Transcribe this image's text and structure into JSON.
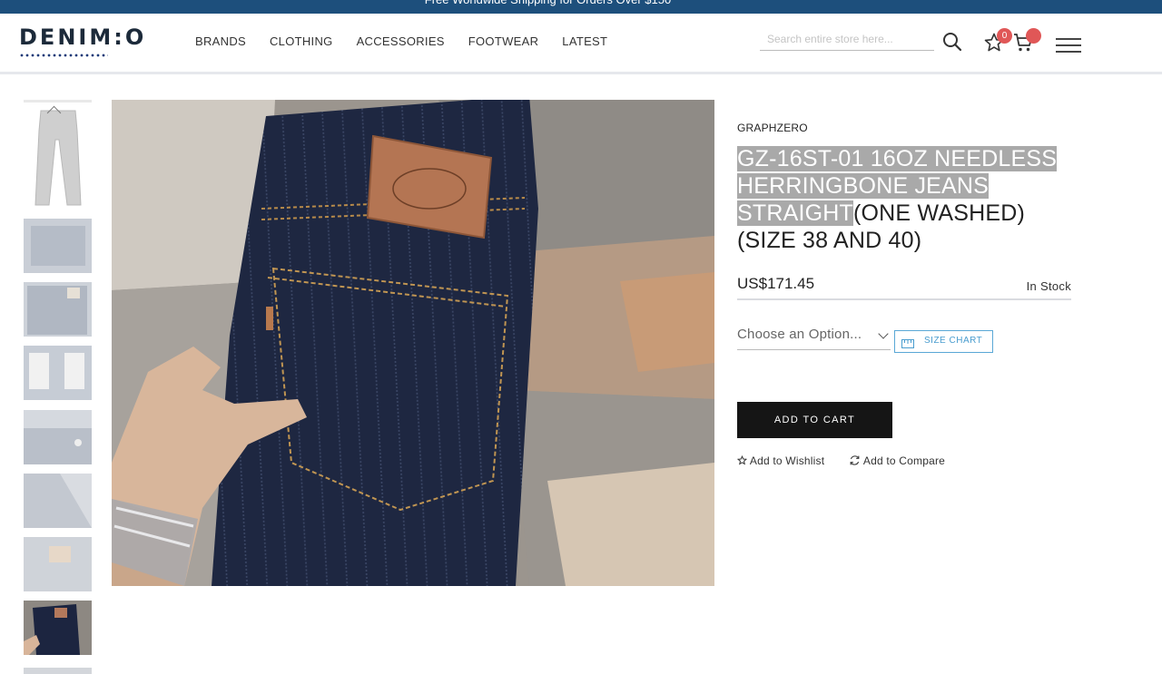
{
  "topbar": {
    "text": "Free Worldwide Shipping for Orders Over $150"
  },
  "header": {
    "logo": "DENIM:O",
    "nav": [
      "BRANDS",
      "CLOTHING",
      "ACCESSORIES",
      "FOOTWEAR",
      "LATEST"
    ],
    "search": {
      "placeholder": "Search entire store here...",
      "value": ""
    },
    "wishlist_count": "0",
    "cart_count": ""
  },
  "product": {
    "brand": "GRAPHZERO",
    "title_highlighted": "GZ-16ST-01 16OZ NEEDLESS HERRINGBONE JEANS STRAIGHT",
    "title_rest": "(ONE WASHED) (SIZE 38 AND 40)",
    "price": "US$171.45",
    "stock": "In Stock",
    "option_placeholder": "Choose an Option...",
    "size_chart_label": "SIZE CHART",
    "add_to_cart_label": "ADD TO CART",
    "wishlist_label": "Add to Wishlist",
    "compare_label": "Add to Compare"
  },
  "gallery": {
    "selected_index": 8,
    "thumbnail_count": 10
  },
  "colors": {
    "topbar": "#1d4f7c",
    "badge": "#e05757",
    "button": "#151515",
    "size_chart": "#5aa8d6"
  }
}
